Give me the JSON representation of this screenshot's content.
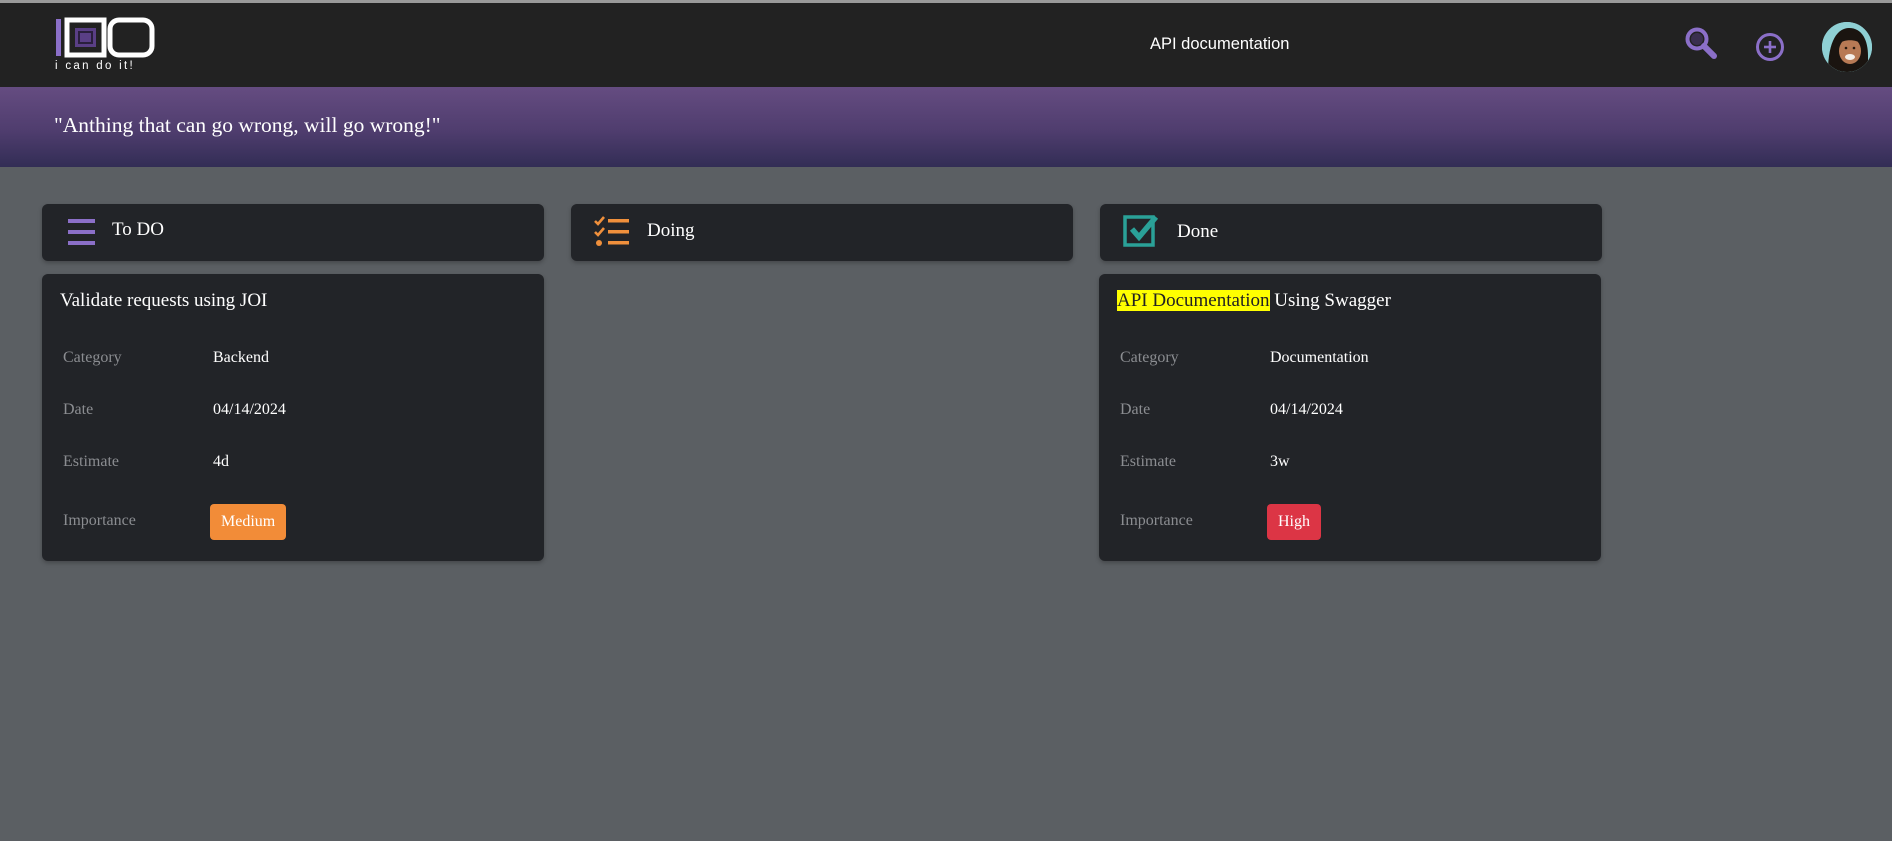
{
  "header": {
    "logo_tagline": "i can do it!",
    "search": {
      "value": "API documentation",
      "placeholder": ""
    },
    "icons": {
      "search": "search-icon",
      "add": "plus-circle-icon",
      "avatar": "user-avatar"
    }
  },
  "banner": {
    "quote": "\"Anthing that can go wrong, will go wrong!\""
  },
  "columns": [
    {
      "title": "To DO",
      "icon": "list-icon",
      "icon_color": "#8b6fc8"
    },
    {
      "title": "Doing",
      "icon": "checklist-icon",
      "icon_color": "#f0903c"
    },
    {
      "title": "Done",
      "icon": "checkbox-checked-icon",
      "icon_color": "#2aa198"
    }
  ],
  "labels": {
    "category": "Category",
    "date": "Date",
    "estimate": "Estimate",
    "importance": "Importance"
  },
  "cards": [
    {
      "column": "To DO",
      "title": "Validate requests using JOI",
      "category": "Backend",
      "date": "04/14/2024",
      "estimate": "4d",
      "importance": "Medium",
      "importance_color": "#f28c38"
    },
    {
      "column": "Done",
      "title_highlight": "API Documentation",
      "title_rest": " Using Swagger",
      "category": "Documentation",
      "date": "04/14/2024",
      "estimate": "3w",
      "importance": "High",
      "importance_color": "#dc3545"
    }
  ],
  "colors": {
    "header_bg": "#222222",
    "page_bg": "#5b5f63",
    "card_bg": "#222428",
    "accent_purple": "#8b6fc8",
    "highlight": "#ffff00"
  }
}
